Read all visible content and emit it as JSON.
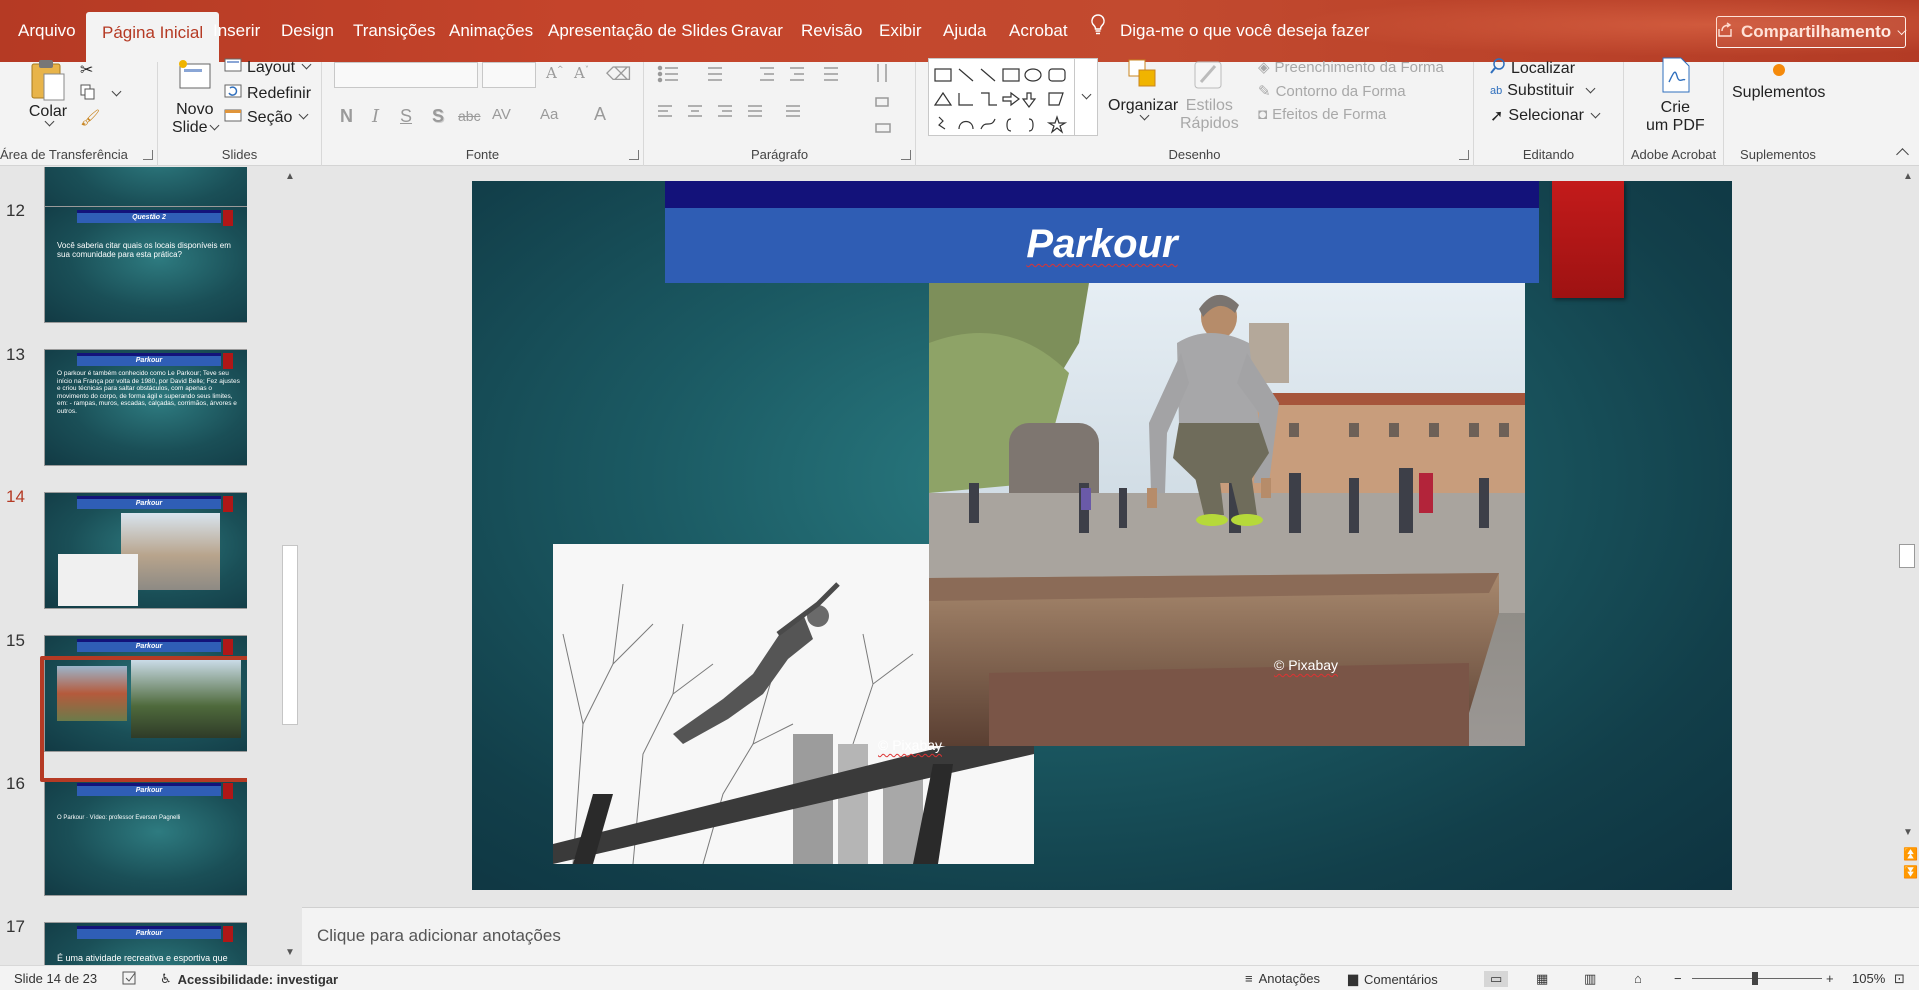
{
  "tabs": {
    "items": [
      "Arquivo",
      "Página Inicial",
      "Inserir",
      "Design",
      "Transições",
      "Animações",
      "Apresentação de Slides",
      "Gravar",
      "Revisão",
      "Exibir",
      "Ajuda",
      "Acrobat"
    ],
    "active": "Página Inicial",
    "tell_me": "Diga-me o que você deseja fazer",
    "share": "Compartilhamento"
  },
  "ribbon": {
    "clipboard": {
      "paste": "Colar",
      "label": "Área de Transferência"
    },
    "slides": {
      "new_slide_1": "Novo",
      "new_slide_2": "Slide",
      "layout": "Layout",
      "reset": "Redefinir",
      "section": "Seção",
      "label": "Slides"
    },
    "font": {
      "label": "Fonte",
      "bold": "N",
      "italic": "I",
      "underline": "S",
      "shadow": "S",
      "strike": "abc",
      "spacing": "AV",
      "case": "Aa",
      "color": "A"
    },
    "paragraph": {
      "label": "Parágrafo"
    },
    "drawing": {
      "arrange": "Organizar",
      "quick_styles_1": "Estilos",
      "quick_styles_2": "Rápidos",
      "fill": "Preenchimento da Forma",
      "outline": "Contorno da Forma",
      "effects": "Efeitos de Forma",
      "label": "Desenho"
    },
    "editing": {
      "find": "Localizar",
      "replace": "Substituir",
      "select": "Selecionar",
      "label": "Editando"
    },
    "acrobat": {
      "create_1": "Crie",
      "create_2": "um PDF",
      "label": "Adobe Acrobat"
    },
    "addins": {
      "button": "Suplementos",
      "label": "Suplementos"
    }
  },
  "thumbnails": [
    {
      "number": "12",
      "title": "Questão 2",
      "text": "Você saberia citar quais os locais disponíveis em sua comunidade para esta prática?"
    },
    {
      "number": "13",
      "title": "Parkour",
      "text": "O parkour é também conhecido como Le Parkour; Teve seu início na França por volta de 1980, por David Belle; Fez ajustes e criou técnicas para saltar obstáculos, com apenas o movimento do corpo, de forma ágil e superando seus limites, em: - rampas, muros, escadas, calçadas, corrimãos, árvores e outros."
    },
    {
      "number": "14",
      "title": "Parkour",
      "text": ""
    },
    {
      "number": "15",
      "title": "Parkour",
      "text": ""
    },
    {
      "number": "16",
      "title": "Parkour",
      "text": "O Parkour · Vídeo: professor Everson Pagnelli"
    },
    {
      "number": "17",
      "title": "Parkour",
      "text": "É uma atividade recreativa e esportiva que"
    }
  ],
  "current_slide": {
    "title": "Parkour",
    "credit_1": "© Pixabay",
    "credit_2": "© Pixabay"
  },
  "notes_placeholder": "Clique para adicionar anotações",
  "status": {
    "slide_count": "Slide 14 de 23",
    "accessibility": "Acessibilidade: investigar",
    "notes": "Anotações",
    "comments": "Comentários",
    "zoom": "105%"
  },
  "colors": {
    "accent": "#b53a24",
    "slide_bg": "#1b5a63",
    "slide_title_bar": "#2f5db4",
    "slide_top_bar": "#13127a",
    "slide_red_block": "#b01717"
  }
}
